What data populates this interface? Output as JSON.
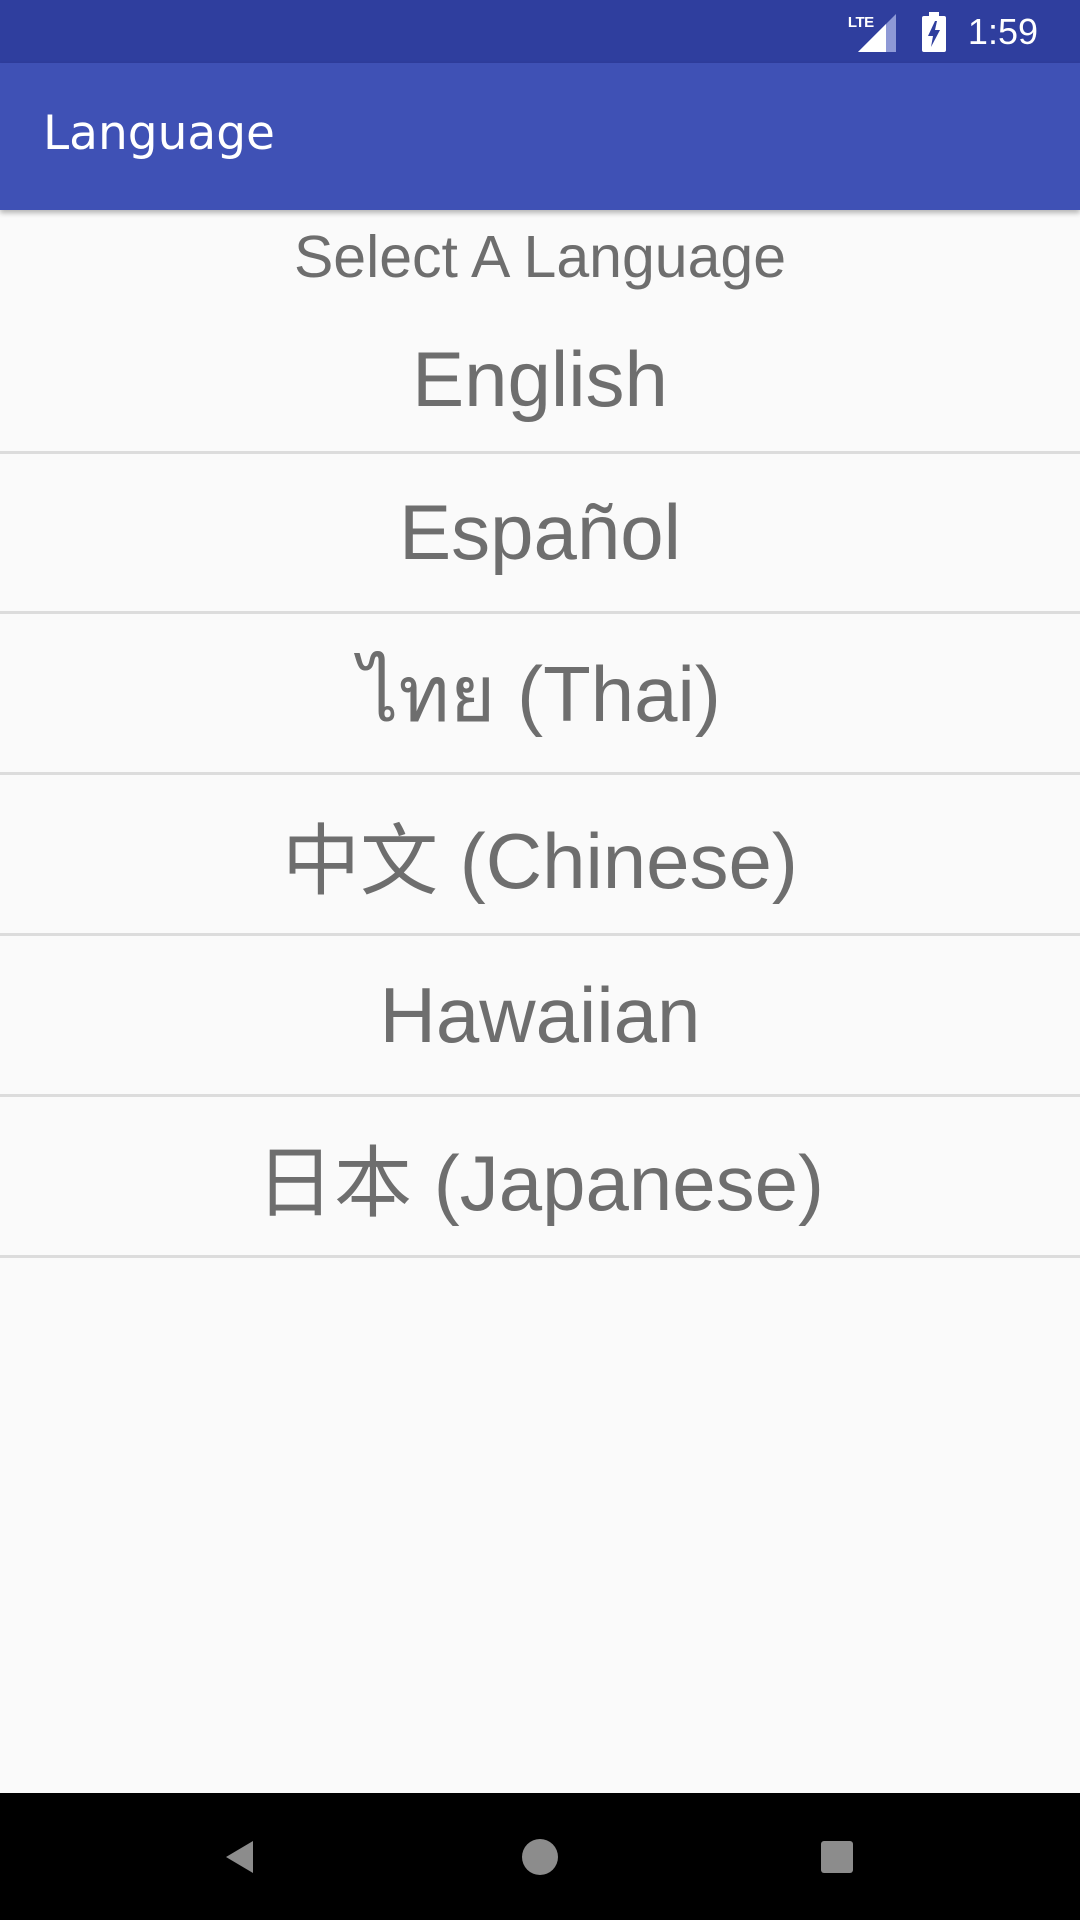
{
  "status_bar": {
    "network_label": "LTE",
    "time": "1:59",
    "icons": [
      "lte-signal-icon",
      "battery-charging-icon"
    ]
  },
  "app_bar": {
    "title": "Language",
    "color": "#3f51b5"
  },
  "main": {
    "prompt": "Select A Language",
    "languages": [
      {
        "label": "English"
      },
      {
        "label": "Español"
      },
      {
        "label": "ไทย (Thai)"
      },
      {
        "label": "中文 (Chinese)"
      },
      {
        "label": "Hawaiian"
      },
      {
        "label": "日本 (Japanese)"
      }
    ]
  },
  "nav_bar": {
    "icons": [
      "back-icon",
      "home-icon",
      "recents-icon"
    ]
  }
}
